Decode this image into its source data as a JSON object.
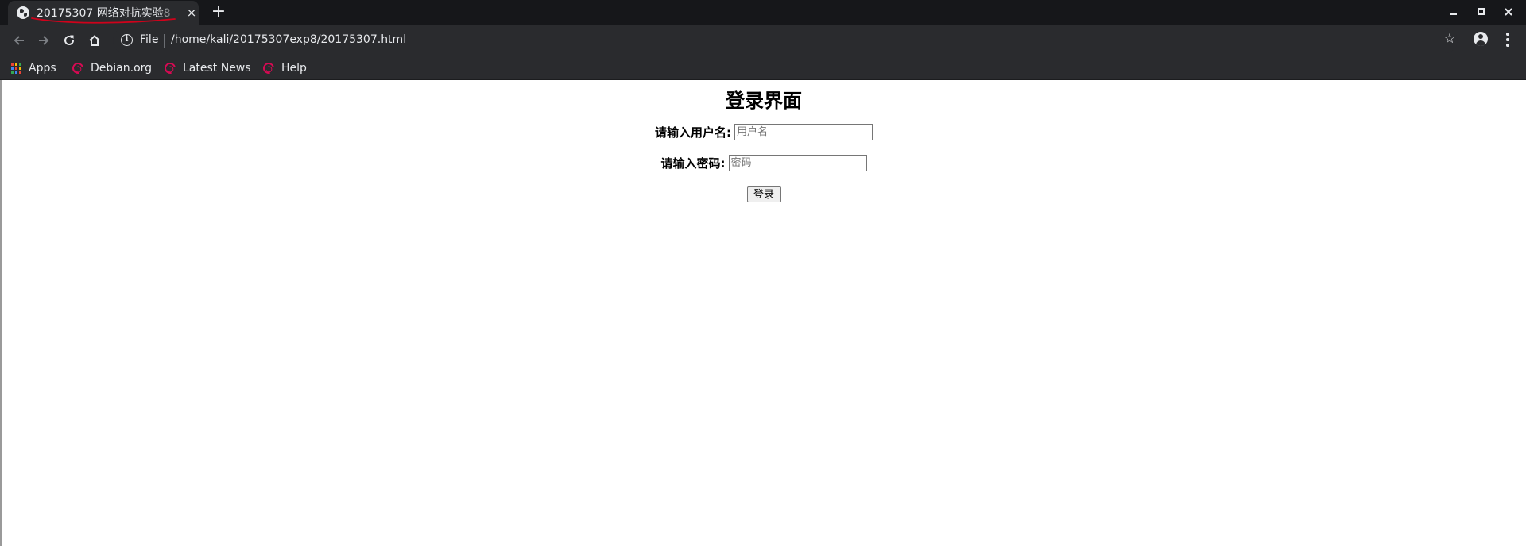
{
  "browser": {
    "tab_title": "20175307 网络对抗实验8",
    "tab_close": "×",
    "new_tab": "+",
    "address": {
      "scheme_label": "File",
      "url": "/home/kali/20175307exp8/20175307.html"
    },
    "bookmarks": [
      {
        "label": "Apps",
        "icon": "apps-grid-icon"
      },
      {
        "label": "Debian.org",
        "icon": "debian-swirl-icon"
      },
      {
        "label": "Latest News",
        "icon": "debian-swirl-icon"
      },
      {
        "label": "Help",
        "icon": "debian-swirl-icon"
      }
    ],
    "colors": {
      "chrome_bg": "#202124",
      "toolbar_bg": "#2a2b2e",
      "debian_red": "#d70a53",
      "annotation_red": "#d0021b"
    }
  },
  "page": {
    "title": "登录界面",
    "username": {
      "label": "请输入用户名:",
      "placeholder": "用户名",
      "value": ""
    },
    "password": {
      "label": "请输入密码:",
      "placeholder": "密码",
      "value": ""
    },
    "submit_label": "登录"
  }
}
